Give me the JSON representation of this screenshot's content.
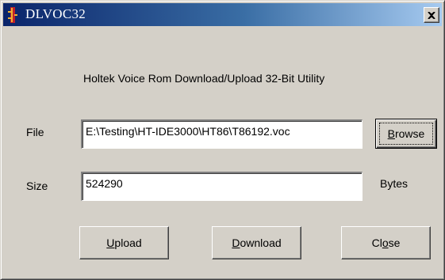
{
  "window": {
    "title": "DLVOC32",
    "close_glyph": "✕"
  },
  "header": {
    "text": "Holtek Voice Rom Download/Upload 32-Bit Utility"
  },
  "file_field": {
    "label_mnemonic": "F",
    "label_rest": "ile",
    "value": "E:\\Testing\\HT-IDE3000\\HT86\\T86192.voc"
  },
  "size_field": {
    "label_mnemonic": "S",
    "label_rest": "ize",
    "value": "524290",
    "units": "Bytes"
  },
  "buttons": {
    "browse": {
      "mnemonic": "B",
      "rest": "rowse"
    },
    "upload": {
      "mnemonic": "U",
      "rest": "pload"
    },
    "download": {
      "mnemonic": "D",
      "rest": "ownload"
    },
    "close": {
      "before": "Cl",
      "mnemonic": "o",
      "rest": "se"
    }
  },
  "colors": {
    "title_gradient_start": "#0a246a",
    "title_gradient_end": "#a6caf0",
    "face": "#d4d0c8"
  },
  "icons": {
    "app": "app-icon",
    "close": "close-icon"
  }
}
